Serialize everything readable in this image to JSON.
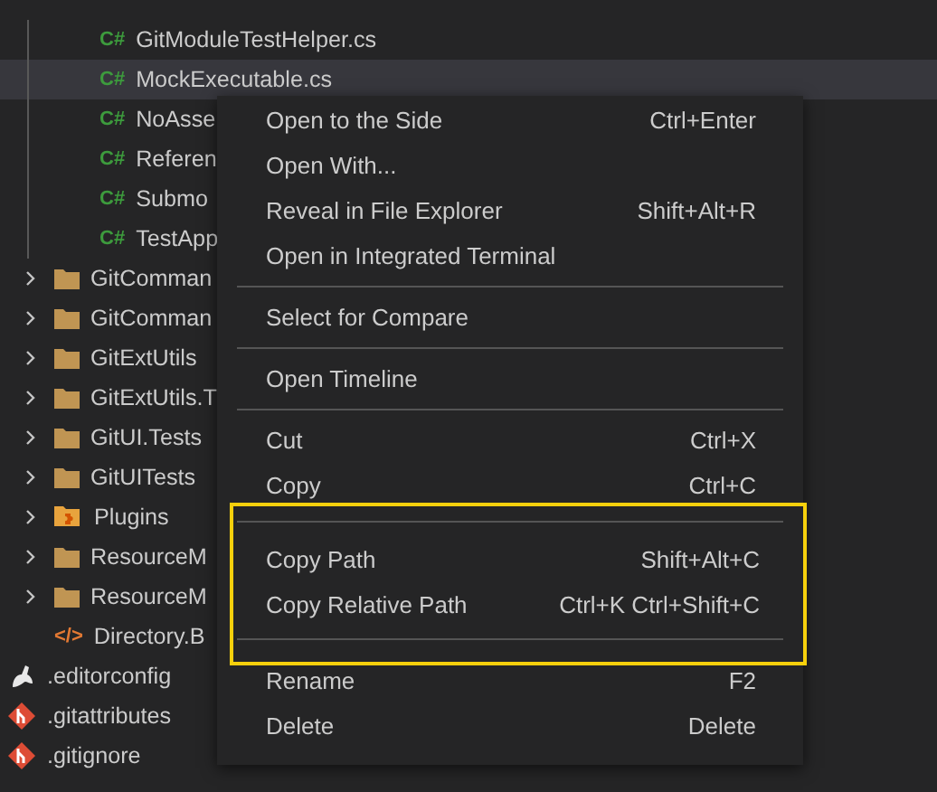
{
  "explorer": {
    "tree": [
      {
        "kind": "group",
        "children": [
          {
            "kind": "group",
            "children": [
              {
                "kind": "code-file",
                "icon_text": "C#",
                "label": "GitModuleTestHelper.cs",
                "selected": false
              },
              {
                "kind": "code-file",
                "icon_text": "C#",
                "label": "MockExecutable.cs",
                "selected": true
              },
              {
                "kind": "code-file",
                "icon_text": "C#",
                "label": "NoAsse",
                "selected": false
              },
              {
                "kind": "code-file",
                "icon_text": "C#",
                "label": "Referen",
                "selected": false
              },
              {
                "kind": "code-file",
                "icon_text": "C#",
                "label": "Submo",
                "selected": false
              },
              {
                "kind": "code-file",
                "icon_text": "C#",
                "label": "TestApp",
                "selected": false
              }
            ]
          },
          {
            "kind": "folder",
            "label": "GitComman",
            "expanded": false,
            "selected": false
          },
          {
            "kind": "folder",
            "label": "GitComman",
            "expanded": false,
            "selected": false
          },
          {
            "kind": "folder",
            "label": "GitExtUtils",
            "expanded": false,
            "selected": false
          },
          {
            "kind": "folder",
            "label": "GitExtUtils.T",
            "expanded": false,
            "selected": false
          },
          {
            "kind": "folder",
            "label": "GitUI.Tests",
            "expanded": false,
            "selected": false
          },
          {
            "kind": "folder",
            "label": "GitUITests",
            "expanded": false,
            "selected": false
          },
          {
            "kind": "plugin-folder",
            "label": "Plugins",
            "expanded": false,
            "selected": false
          },
          {
            "kind": "folder",
            "label": "ResourceM",
            "expanded": false,
            "selected": false
          },
          {
            "kind": "folder",
            "label": "ResourceM",
            "expanded": false,
            "selected": false
          },
          {
            "kind": "markup-file",
            "icon_text": "</>",
            "label": "Directory.B",
            "selected": false
          }
        ]
      },
      {
        "kind": "config-file",
        "label": ".editorconfig",
        "selected": false
      },
      {
        "kind": "git-file",
        "label": ".gitattributes",
        "selected": false
      },
      {
        "kind": "git-file",
        "label": ".gitignore",
        "selected": false
      }
    ]
  },
  "context_menu": {
    "sections": [
      {
        "highlighted": false,
        "items": [
          {
            "label": "Open to the Side",
            "shortcut": "Ctrl+Enter"
          },
          {
            "label": "Open With..."
          },
          {
            "label": "Reveal in File Explorer",
            "shortcut": "Shift+Alt+R"
          },
          {
            "label": "Open in Integrated Terminal"
          }
        ]
      },
      {
        "highlighted": false,
        "items": [
          {
            "label": "Select for Compare"
          }
        ]
      },
      {
        "highlighted": false,
        "items": [
          {
            "label": "Open Timeline"
          }
        ]
      },
      {
        "highlighted": false,
        "items": [
          {
            "label": "Cut",
            "shortcut": "Ctrl+X"
          },
          {
            "label": "Copy",
            "shortcut": "Ctrl+C"
          }
        ]
      },
      {
        "highlighted": true,
        "items": [
          {
            "label": "Copy Path",
            "shortcut": "Shift+Alt+C"
          },
          {
            "label": "Copy Relative Path",
            "shortcut": "Ctrl+K Ctrl+Shift+C"
          }
        ]
      },
      {
        "highlighted": false,
        "items": [
          {
            "label": "Rename",
            "shortcut": "F2"
          },
          {
            "label": "Delete",
            "shortcut": "Delete"
          }
        ]
      }
    ]
  }
}
